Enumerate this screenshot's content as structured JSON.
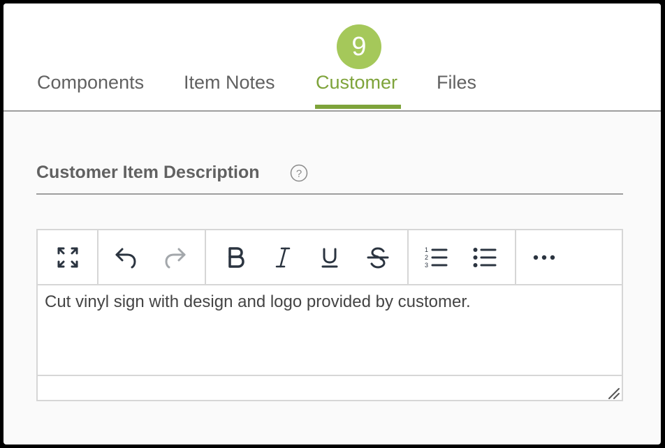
{
  "tabs": [
    {
      "label": "Components",
      "active": false
    },
    {
      "label": "Item Notes",
      "active": false
    },
    {
      "label": "Customer",
      "active": true
    },
    {
      "label": "Files",
      "active": false
    }
  ],
  "customer_tab_badge": "9",
  "section": {
    "title": "Customer Item Description",
    "help_icon": "question-circle-icon"
  },
  "editor": {
    "toolbar_buttons": [
      "fullscreen-icon",
      "undo-icon",
      "redo-icon",
      "bold-icon",
      "italic-icon",
      "underline-icon",
      "strikethrough-icon",
      "ordered-list-icon",
      "unordered-list-icon",
      "more-icon"
    ],
    "content": "Cut vinyl sign with design and logo provided by customer.",
    "redo_enabled": false
  },
  "colors": {
    "accent": "#7ea33a",
    "badge": "#a5c85a",
    "text": "#616161",
    "border": "#d6d6d6"
  }
}
